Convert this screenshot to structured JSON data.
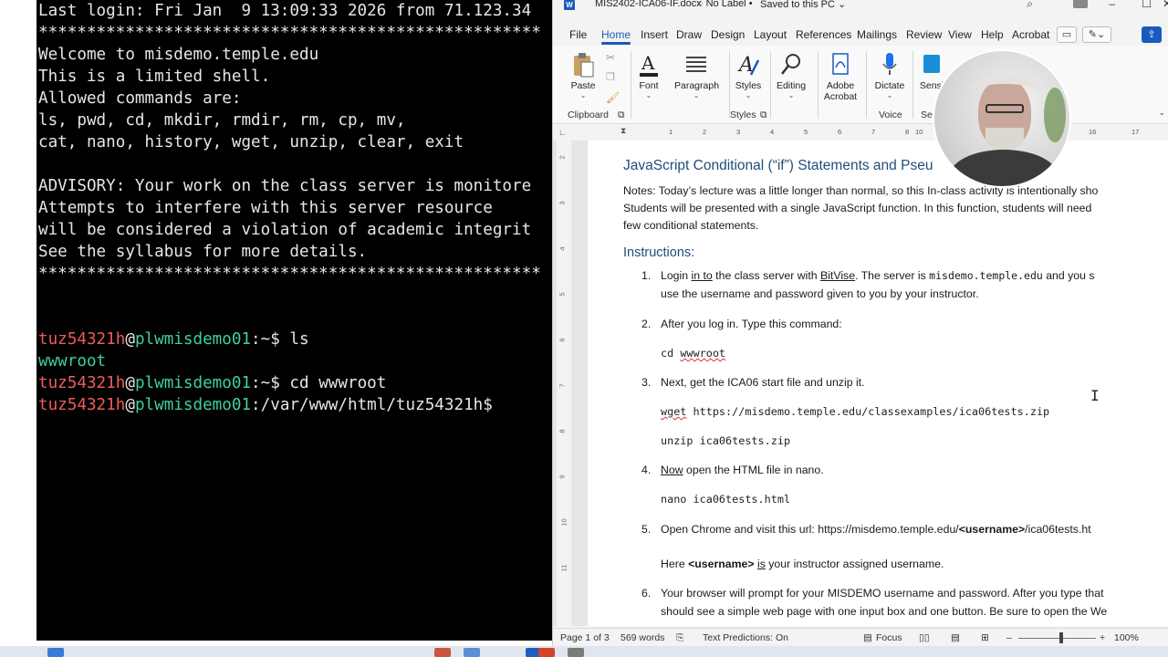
{
  "terminal": {
    "lines": [
      "Last login: Fri Jan  9 13:09:33 2026 from 71.123.34",
      "****************************************************",
      "Welcome to misdemo.temple.edu",
      "This is a limited shell.",
      "Allowed commands are:",
      "ls, pwd, cd, mkdir, rmdir, rm, cp, mv,",
      "cat, nano, history, wget, unzip, clear, exit",
      "",
      "ADVISORY: Your work on the class server is monitore",
      "Attempts to interfere with this server resource",
      "will be considered a violation of academic integrit",
      "See the syllabus for more details.",
      "****************************************************"
    ],
    "prompt_user": "tuz54321h",
    "prompt_at": "@",
    "prompt_host": "plwmisdemo01",
    "prompt1_path": ":~$ ",
    "prompt1_cmd": "ls",
    "ls_output": "wwwroot",
    "prompt2_path": ":~$ ",
    "prompt2_cmd": "cd wwwroot",
    "prompt3_path": ":/var/www/html/tuz54321h$"
  },
  "word": {
    "titlebar": {
      "app_icon": "W",
      "filename": "MIS2402-ICA06-IF.docx",
      "label": "No Label",
      "saved": "Saved to this PC",
      "search_icon": "search-icon",
      "minimize": "–",
      "maximize": "☐",
      "close": "✕"
    },
    "menu": [
      "File",
      "Home",
      "Insert",
      "Draw",
      "Design",
      "Layout",
      "References",
      "Mailings",
      "Review",
      "View",
      "Help",
      "Acrobat"
    ],
    "active_menu": "Home",
    "ribbon": {
      "paste": "Paste",
      "font": "Font",
      "paragraph": "Paragraph",
      "styles": "Styles",
      "editing": "Editing",
      "adobe_acrobat_1": "Adobe",
      "adobe_acrobat_2": "Acrobat",
      "dictate": "Dictate",
      "sensitivity": "Sensi",
      "groups": {
        "clipboard": "Clipboard",
        "styles": "Styles",
        "voice": "Voice",
        "sensitivity": "Se"
      }
    },
    "ruler_marks": [
      "1",
      "2",
      "3",
      "4",
      "5",
      "6",
      "7",
      "8",
      "9",
      "10",
      "16",
      "17"
    ],
    "doc": {
      "title": "JavaScript Conditional (“if”) Statements and Pseu",
      "notes_1": "Notes: Today’s lecture was a little longer than normal, so this In-class activity is intentionally sho",
      "notes_2": "Students will be presented with a single JavaScript function.  In this function, students will need",
      "notes_3": "few conditional statements.",
      "instructions_heading": "Instructions:",
      "step1_num": "1.",
      "step1_a": "Login ",
      "step1_inTo": "in to",
      "step1_b": " the class server with ",
      "step1_bitvise": "BitVise",
      "step1_c": ".  The server is ",
      "step1_server": "misdemo.temple.edu",
      "step1_d": " and you s",
      "step1_line2": "use the username and password given to you by your instructor.",
      "step2_num": "2.",
      "step2_text": "After you log in.  Type this command:",
      "step2_code_a": "cd ",
      "step2_code_b": "wwwroot",
      "step3_num": "3.",
      "step3_text": "Next, get the ICA06 start file and unzip it.",
      "step3_code1_a": "wget",
      "step3_code1_b": " https://misdemo.temple.edu/classexamples/ica06tests.zip",
      "step3_code2": "unzip ica06tests.zip",
      "step4_num": "4.",
      "step4_now": "Now",
      "step4_text": " open the HTML file in nano.",
      "step4_code": "nano ica06tests.html",
      "step5_num": "5.",
      "step5_a": "Open Chrome and visit this url: https://misdemo.temple.edu/",
      "step5_b": "<username>",
      "step5_c": "/ica06tests.ht",
      "step5_here_a": "Here ",
      "step5_here_b": "<username>",
      "step5_here_c": " ",
      "step5_here_is": "is",
      "step5_here_d": " your instructor assigned username.",
      "step6_num": "6.",
      "step6_line1": "Your browser will prompt for your MISDEMO username and password.  After you type that",
      "step6_line2": "should see a simple web page with one input box and one button.  Be sure to open the We"
    },
    "status": {
      "page": "Page 1 of 3",
      "words": "569 words",
      "predictions": "Text Predictions: On",
      "focus": "Focus",
      "zoom_minus": "–",
      "zoom_plus": "+",
      "zoom": "100%",
      "zoom_level": 0.55
    }
  }
}
